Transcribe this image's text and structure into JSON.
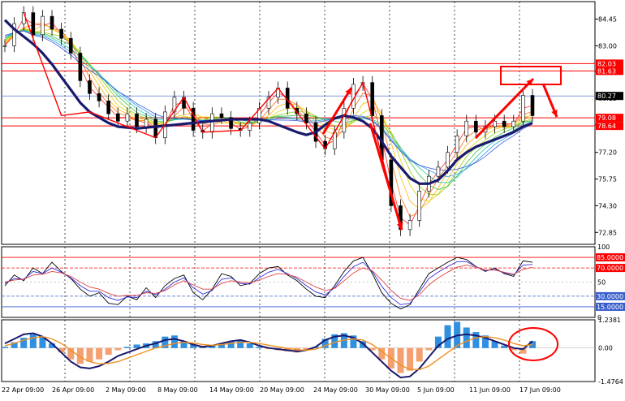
{
  "colors": {
    "background": "#ffffff",
    "frame": "#000000",
    "candle": "#000000",
    "ma_thick": "#1a1a6e",
    "signal_red": "#ff0000",
    "level_blue": "#3a5fcd",
    "rsi_fast": "#000000",
    "rsi_mid": "#3030e0",
    "rsi_slow": "#e04040",
    "hist_pos": "#2f8fe0",
    "hist_neg": "#f4a070",
    "macd_line": "#1a1a6e",
    "signal_line": "#f09020",
    "price_tag_red": "#ff0000",
    "price_tag_black": "#000000"
  },
  "chart_data": [
    {
      "type": "line",
      "panel": "price",
      "y_range": [
        72.2,
        85.4
      ],
      "y_ticks": [
        "84.45",
        "83.00",
        "81.60",
        "80.15",
        "78.70",
        "77.20",
        "75.75",
        "74.30",
        "72.85"
      ],
      "price_tags": [
        {
          "label": "82.03",
          "value": 82.03,
          "style": "red"
        },
        {
          "label": "81.63",
          "value": 81.63,
          "style": "red"
        },
        {
          "label": "80.27",
          "value": 80.27,
          "style": "black"
        },
        {
          "label": "79.08",
          "value": 79.08,
          "style": "red"
        },
        {
          "label": "78.64",
          "value": 78.64,
          "style": "red"
        }
      ],
      "x_labels": [
        "22 Apr 09:00",
        "26 Apr 09:00",
        "2 May 09:00",
        "8 May 09:00",
        "14 May 09:00",
        "20 May 09:00",
        "24 May 09:00",
        "30 May 09:00",
        "5 Jun 09:00",
        "11 Jun 09:00",
        "17 Jun 09:00"
      ],
      "close_points": [
        83.0,
        84.2,
        84.8,
        83.6,
        84.6,
        83.9,
        83.4,
        82.6,
        81.1,
        80.4,
        80.0,
        79.3,
        78.9,
        79.3,
        78.6,
        79.0,
        78.0,
        79.4,
        80.2,
        79.6,
        78.4,
        78.3,
        79.3,
        79.1,
        78.5,
        78.4,
        78.8,
        79.6,
        80.2,
        80.7,
        79.6,
        79.3,
        78.8,
        77.8,
        77.4,
        78.3,
        79.6,
        80.9,
        81.0,
        79.2,
        76.8,
        74.3,
        73.0,
        73.5,
        75.1,
        75.9,
        76.4,
        77.2,
        78.1,
        78.9,
        78.3,
        78.6,
        78.9,
        78.6,
        78.9,
        80.3,
        79.2
      ],
      "ma_points": [
        84.4,
        83.9,
        83.5,
        83.1,
        82.6,
        82.0,
        81.3,
        80.6,
        79.9,
        79.4,
        79.1,
        78.8,
        78.6,
        78.55,
        78.5,
        78.55,
        78.6,
        78.65,
        78.7,
        78.75,
        78.8,
        78.85,
        78.9,
        78.95,
        79.0,
        79.0,
        79.0,
        79.0,
        78.9,
        78.7,
        78.5,
        78.3,
        78.15,
        78.3,
        78.7,
        79.05,
        79.2,
        79.1,
        78.9,
        78.5,
        77.8,
        77.0,
        76.4,
        75.8,
        75.5,
        75.5,
        75.7,
        76.2,
        76.8,
        77.2,
        77.5,
        77.7,
        77.9,
        78.1,
        78.3,
        78.6,
        78.8
      ]
    },
    {
      "type": "line",
      "panel": "rsi",
      "y_range": [
        0,
        100
      ],
      "y_ticks": [
        "100",
        "50",
        "0"
      ],
      "levels": [
        {
          "label": "85.0000",
          "value": 85,
          "color": "red"
        },
        {
          "label": "70.0000",
          "value": 70,
          "color": "red"
        },
        {
          "label": "30.0000",
          "value": 30,
          "color": "blue"
        },
        {
          "label": "15.0000",
          "value": 15,
          "color": "blue"
        }
      ],
      "series": [
        {
          "values": [
            45,
            60,
            52,
            70,
            62,
            78,
            65,
            55,
            40,
            30,
            35,
            20,
            18,
            30,
            25,
            42,
            28,
            45,
            55,
            60,
            35,
            25,
            40,
            62,
            58,
            45,
            48,
            62,
            70,
            72,
            60,
            52,
            40,
            30,
            28,
            45,
            65,
            80,
            85,
            62,
            35,
            20,
            12,
            18,
            40,
            62,
            70,
            78,
            85,
            82,
            72,
            65,
            70,
            62,
            58,
            80,
            78
          ]
        },
        {
          "values": [
            48,
            55,
            54,
            65,
            62,
            70,
            64,
            56,
            45,
            37,
            37,
            28,
            24,
            29,
            28,
            37,
            32,
            40,
            50,
            56,
            42,
            33,
            38,
            54,
            56,
            48,
            47,
            56,
            64,
            68,
            62,
            55,
            45,
            36,
            32,
            42,
            58,
            72,
            78,
            65,
            44,
            28,
            18,
            20,
            36,
            55,
            64,
            72,
            79,
            79,
            72,
            66,
            68,
            63,
            60,
            74,
            75
          ]
        },
        {
          "values": [
            50,
            53,
            54,
            60,
            61,
            65,
            63,
            58,
            50,
            43,
            40,
            34,
            30,
            31,
            31,
            35,
            34,
            38,
            46,
            52,
            46,
            40,
            40,
            48,
            52,
            50,
            49,
            53,
            58,
            62,
            61,
            57,
            50,
            43,
            38,
            41,
            52,
            63,
            70,
            66,
            53,
            38,
            27,
            24,
            32,
            46,
            56,
            64,
            71,
            74,
            71,
            67,
            67,
            64,
            61,
            68,
            71
          ]
        }
      ]
    },
    {
      "type": "bar",
      "panel": "macd",
      "y_range": [
        -1.4764,
        1.2381
      ],
      "y_ticks": [
        "1.2381",
        "0.00",
        "-1.4764"
      ],
      "histogram": [
        0.05,
        0.25,
        0.45,
        0.6,
        0.5,
        0.2,
        -0.2,
        -0.5,
        -0.7,
        -0.6,
        -0.5,
        -0.3,
        -0.1,
        0.05,
        0.15,
        0.2,
        0.3,
        0.5,
        0.55,
        0.3,
        0.15,
        0.05,
        0.1,
        0.2,
        0.3,
        0.35,
        0.2,
        0.05,
        -0.05,
        -0.1,
        -0.15,
        -0.2,
        -0.1,
        0.05,
        0.4,
        0.6,
        0.65,
        0.55,
        0.3,
        -0.1,
        -0.5,
        -0.9,
        -1.1,
        -1.0,
        -0.6,
        -0.1,
        0.5,
        1.0,
        1.15,
        0.9,
        0.7,
        0.55,
        0.3,
        0.1,
        -0.1,
        -0.25,
        0.3
      ],
      "macd_line": [
        0.2,
        0.4,
        0.6,
        0.65,
        0.5,
        0.2,
        -0.2,
        -0.6,
        -0.85,
        -0.9,
        -0.8,
        -0.6,
        -0.35,
        -0.2,
        -0.05,
        0.1,
        0.2,
        0.35,
        0.4,
        0.3,
        0.15,
        0.05,
        0.1,
        0.2,
        0.3,
        0.35,
        0.25,
        0.1,
        0.0,
        -0.05,
        -0.1,
        -0.15,
        -0.1,
        0.05,
        0.35,
        0.5,
        0.55,
        0.45,
        0.2,
        -0.2,
        -0.6,
        -1.0,
        -1.3,
        -1.25,
        -0.9,
        -0.4,
        0.1,
        0.4,
        0.55,
        0.6,
        0.55,
        0.45,
        0.3,
        0.15,
        0.0,
        -0.05,
        0.3
      ],
      "signal_line": [
        0.1,
        0.2,
        0.35,
        0.45,
        0.5,
        0.4,
        0.2,
        -0.1,
        -0.4,
        -0.6,
        -0.7,
        -0.68,
        -0.6,
        -0.45,
        -0.3,
        -0.15,
        0.0,
        0.1,
        0.2,
        0.25,
        0.22,
        0.15,
        0.12,
        0.15,
        0.2,
        0.25,
        0.25,
        0.2,
        0.12,
        0.05,
        -0.02,
        -0.08,
        -0.1,
        -0.05,
        0.1,
        0.25,
        0.35,
        0.4,
        0.35,
        0.15,
        -0.15,
        -0.45,
        -0.75,
        -0.95,
        -0.95,
        -0.8,
        -0.5,
        -0.2,
        0.1,
        0.3,
        0.45,
        0.5,
        0.45,
        0.35,
        0.2,
        0.1,
        0.15
      ]
    }
  ]
}
